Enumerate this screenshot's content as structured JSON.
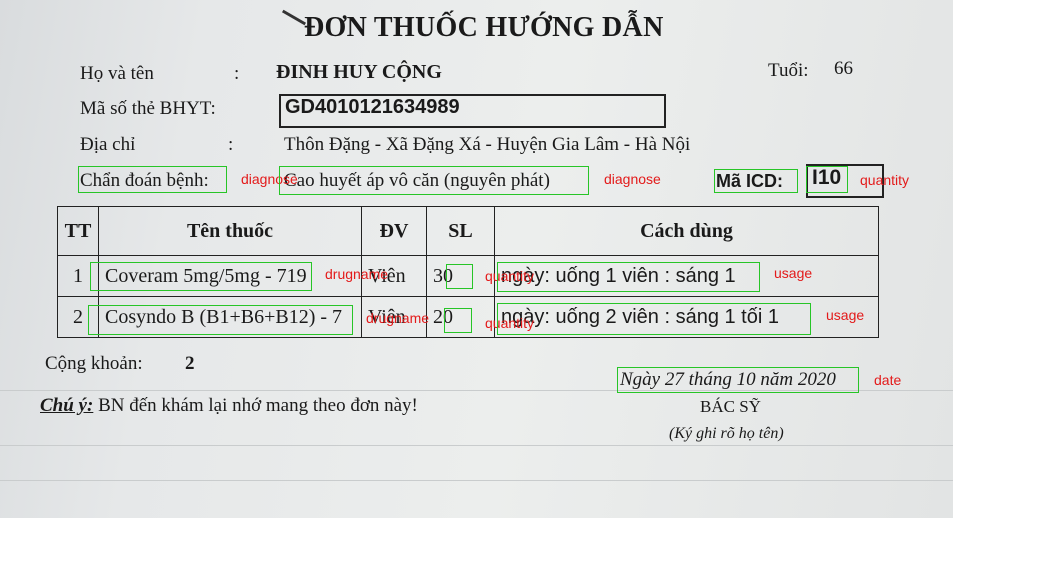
{
  "document": {
    "title": "ĐƠN THUỐC HƯỚNG DẪN",
    "patient": {
      "name_label": "Họ và tên",
      "name_colon": ":",
      "name": "ĐINH HUY CỘNG",
      "age_label": "Tuổi:",
      "age": "66",
      "insurance_label": "Mã số thẻ BHYT:",
      "insurance_no": "GD4010121634989",
      "address_label": "Địa chỉ",
      "address_colon": ":",
      "address": "Thôn Đặng - Xã Đặng Xá - Huyện Gia Lâm - Hà Nội"
    },
    "diagnosis": {
      "label": "Chẩn đoán bệnh:",
      "value": "Cao huyết áp vô căn (nguyên phát)",
      "icd_label": "Mã ICD:",
      "icd_code": "I10"
    },
    "table": {
      "headers": [
        "TT",
        "Tên thuốc",
        "ĐV",
        "SL",
        "Cách dùng"
      ],
      "rows": [
        {
          "tt": "1",
          "name": "Coveram 5mg/5mg - 719",
          "unit": "Viên",
          "qty": "30",
          "usage": "ngày: uống 1 viên : sáng 1"
        },
        {
          "tt": "2",
          "name": "Cosyndo B (B1+B6+B12) - 7",
          "unit": "Viên",
          "qty": "20",
          "usage": "ngày: uống 2 viên : sáng 1 tối 1"
        }
      ]
    },
    "total": {
      "label": "Cộng khoản:",
      "value": "2"
    },
    "note": {
      "label": "Chú ý:",
      "text": "BN đến khám lại nhớ mang theo đơn này!"
    },
    "date": "Ngày 27 tháng 10 năm 2020",
    "signature": {
      "title": "BÁC SỸ",
      "hint": "(Ký ghi rõ họ tên)"
    }
  },
  "annotations": {
    "diagnose_label_1": "diagnose",
    "diagnose_label_2": "diagnose",
    "quantity_label": "quantity",
    "drugname_1": "drugname",
    "drugname_2": "drugname",
    "quantity_row1": "quantity",
    "quantity_row2": "quantity",
    "usage_1": "usage",
    "usage_2": "usage",
    "date_label": "date",
    "box_color": "#27c527",
    "label_color": "#e31a1a"
  }
}
